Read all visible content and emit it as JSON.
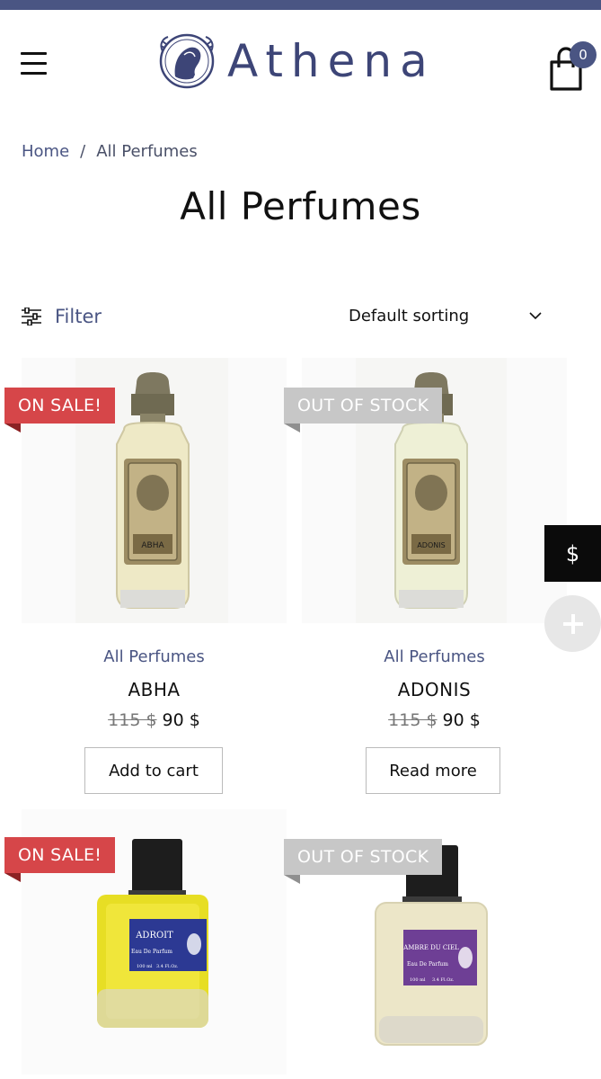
{
  "header": {
    "brand_name": "Athena",
    "cart_count": "0",
    "menu_icon": "hamburger-icon",
    "cart_icon": "shopping-bag-icon"
  },
  "breadcrumb": {
    "home": "Home",
    "separator": "/",
    "current": "All Perfumes"
  },
  "page_title": "All Perfumes",
  "toolbar": {
    "filter_label": "Filter",
    "filter_icon": "sliders-icon",
    "sort_selected": "Default sorting",
    "sort_icon": "chevron-down-icon"
  },
  "products": [
    {
      "badge": "ON SALE!",
      "category": "All Perfumes",
      "name": "ABHA",
      "old_price": "115 $",
      "price": "90 $",
      "button": "Add to cart",
      "bottle_label": "ABHA"
    },
    {
      "badge": "OUT OF STOCK",
      "category": "All Perfumes",
      "name": "ADONIS",
      "old_price": "115 $",
      "price": "90 $",
      "button": "Read more",
      "bottle_label": "ADONIS"
    },
    {
      "badge": "ON SALE!",
      "bottle_label": "ADROIT",
      "bottle_sub": "Eau De Parfum",
      "bottle_vol": "100 ml",
      "bottle_oz": "3.4 Fl.Oz."
    },
    {
      "badge": "OUT OF STOCK",
      "bottle_label": "AMBRE DU CIEL",
      "bottle_sub": "Eau De Parfum",
      "bottle_vol": "100 ml",
      "bottle_oz": "3.4 Fl.Oz."
    }
  ],
  "floating": {
    "currency_label": "$",
    "plus_icon": "plus-icon"
  },
  "colors": {
    "accent": "#4a5583",
    "sale_badge": "#d64649",
    "out_of_stock_badge": "#c7c7c7"
  }
}
